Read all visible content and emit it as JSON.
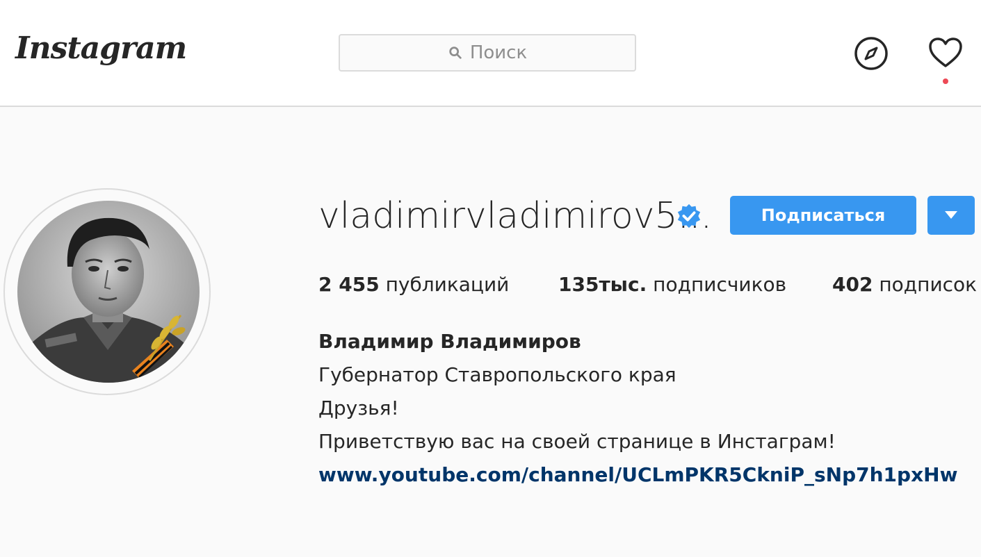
{
  "header": {
    "logo_text": "Instagram",
    "search_placeholder": "Поиск"
  },
  "profile": {
    "username": "vladimirvladimirov5...",
    "verified": true,
    "follow_label": "Подписаться",
    "stats": {
      "posts_value": "2 455",
      "posts_label": "публикаций",
      "followers_value": "135тыс.",
      "followers_label": "подписчиков",
      "following_value": "402",
      "following_label": "подписок"
    },
    "full_name": "Владимир Владимиров",
    "bio_lines": [
      "Губернатор Ставропольского края",
      "Друзья!",
      "Приветствую вас на своей странице в Инстаграм!"
    ],
    "link": "www.youtube.com/channel/UCLmPKR5CkniP_sNp7h1pxHw"
  },
  "colors": {
    "accent": "#3897f0",
    "link": "#003569",
    "notification": "#ed4956"
  }
}
